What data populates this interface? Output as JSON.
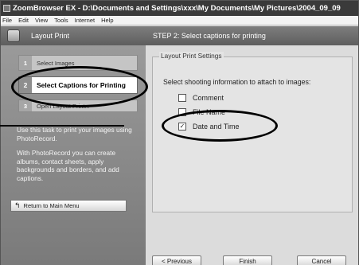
{
  "titlebar": {
    "title": "ZoomBrowser EX  -  D:\\Documents and Settings\\xxx\\My Documents\\My Pictures\\2004_09_09"
  },
  "menu": [
    "File",
    "Edit",
    "View",
    "Tools",
    "Internet",
    "Help"
  ],
  "header": {
    "title": "Layout Print",
    "step": "STEP 2: Select captions for printing"
  },
  "sidebar": {
    "steps": [
      {
        "num": "1",
        "label": "Select Images"
      },
      {
        "num": "2",
        "label": "Select Captions for Printing"
      },
      {
        "num": "3",
        "label": "Open Layout Print..."
      }
    ],
    "description1": "Use this task to print your images using PhotoRecord.",
    "description2": "With PhotoRecord you can create albums, contact sheets, apply backgrounds and borders, and add captions.",
    "return_label": "Return to Main Menu"
  },
  "panel": {
    "legend": "Layout Print Settings",
    "prompt": "Select shooting information to attach to images:",
    "options": [
      {
        "label": "Comment",
        "checked": false,
        "mark": ""
      },
      {
        "label": "File Name",
        "checked": false,
        "mark": ""
      },
      {
        "label": "Date and Time",
        "checked": true,
        "mark": "✓"
      }
    ]
  },
  "buttons": {
    "previous": "< Previous",
    "finish": "Finish",
    "cancel": "Cancel"
  }
}
